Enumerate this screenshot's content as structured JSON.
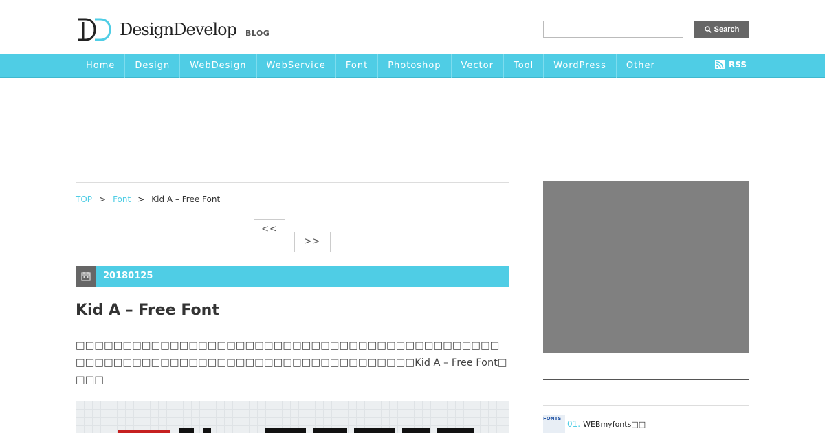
{
  "header": {
    "logo_text": "DesignDevelop",
    "logo_tag": "BLOG",
    "search_placeholder": "",
    "search_label": "Search"
  },
  "nav": {
    "items": [
      "Home",
      "Design",
      "WebDesign",
      "WebService",
      "Font",
      "Photoshop",
      "Vector",
      "Tool",
      "WordPress",
      "Other"
    ],
    "rss_label": "RSS"
  },
  "breadcrumb": {
    "top": "TOP",
    "category": "Font",
    "current": "Kid A – Free Font",
    "separator": ">"
  },
  "pager": {
    "prev": "<<",
    "next": ">>"
  },
  "post": {
    "date": "20180125",
    "title": "Kid A – Free Font",
    "body": "□□□□□□□□□□□□□□□□□□□□□□□□□□□□□□□□□□□□□□□□□□□□□□□□□□□□□□□□□□□□□□□□□□□□□□□□□□□□□□□□□Kid A – Free Font□□□□"
  },
  "sidebar": {
    "ranking": [
      {
        "num": "01.",
        "title": "WEBmyfonts□□",
        "thumb_text": "FONTS"
      }
    ]
  },
  "colors": {
    "accent": "#4fcde5",
    "nav_divider": "#7ddcee",
    "button_dark": "#666666",
    "ad_placeholder": "#808080"
  },
  "icons": {
    "search": "search-icon",
    "rss": "rss-icon",
    "calendar": "calendar-icon"
  }
}
